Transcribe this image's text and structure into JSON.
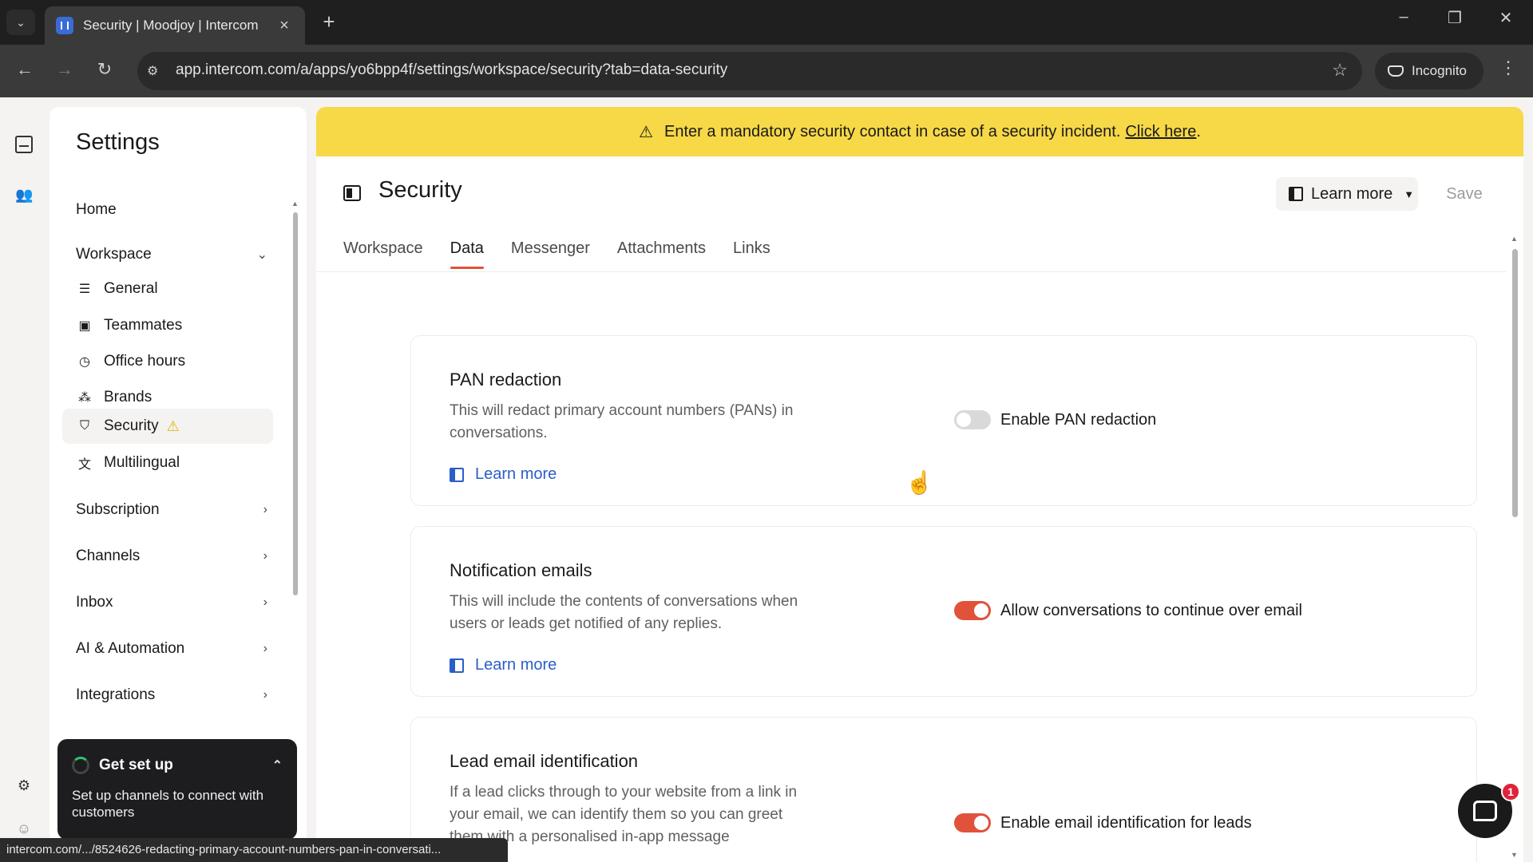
{
  "browser": {
    "tab_title": "Security | Moodjoy | Intercom",
    "url": "app.intercom.com/a/apps/yo6bpp4f/settings/workspace/security?tab=data-security",
    "incognito_label": "Incognito",
    "status_url": "intercom.com/.../8524626-redacting-primary-account-numbers-pan-in-conversati..."
  },
  "sidebar": {
    "title": "Settings",
    "home": "Home",
    "workspace": "Workspace",
    "workspace_items": [
      {
        "label": "General",
        "icon": "lines-icon"
      },
      {
        "label": "Teammates",
        "icon": "person-card-icon"
      },
      {
        "label": "Office hours",
        "icon": "clock-icon"
      },
      {
        "label": "Brands",
        "icon": "brands-icon"
      },
      {
        "label": "Security",
        "icon": "shield-icon",
        "active": true,
        "warning": true
      },
      {
        "label": "Multilingual",
        "icon": "translate-icon"
      }
    ],
    "sections": [
      "Subscription",
      "Channels",
      "Inbox",
      "AI & Automation",
      "Integrations"
    ]
  },
  "get_setup": {
    "title": "Get set up",
    "body": "Set up channels to connect with customers"
  },
  "banner": {
    "text": "Enter a mandatory security contact in case of a security incident.",
    "link": "Click here",
    "trailing": "."
  },
  "page": {
    "title": "Security",
    "learn_more": "Learn more",
    "save": "Save",
    "tabs": [
      "Workspace",
      "Data",
      "Messenger",
      "Attachments",
      "Links"
    ],
    "active_tab": "Data"
  },
  "cards": [
    {
      "title": "PAN redaction",
      "description": "This will redact primary account numbers (PANs) in conversations.",
      "link": "Learn more",
      "toggle_label": "Enable PAN redaction",
      "toggle_on": false
    },
    {
      "title": "Notification emails",
      "description": "This will include the contents of conversations when users or leads get notified of any replies.",
      "link": "Learn more",
      "toggle_label": "Allow conversations to continue over email",
      "toggle_on": true
    },
    {
      "title": "Lead email identification",
      "description": "If a lead clicks through to your website from a link in your email, we can identify them so you can greet them with a personalised in-app message",
      "toggle_label": "Enable email identification for leads",
      "toggle_on": true
    }
  ],
  "messenger_badge": "1",
  "colors": {
    "accent": "#e0523a",
    "banner": "#f7d847",
    "link": "#2a5ec8"
  }
}
